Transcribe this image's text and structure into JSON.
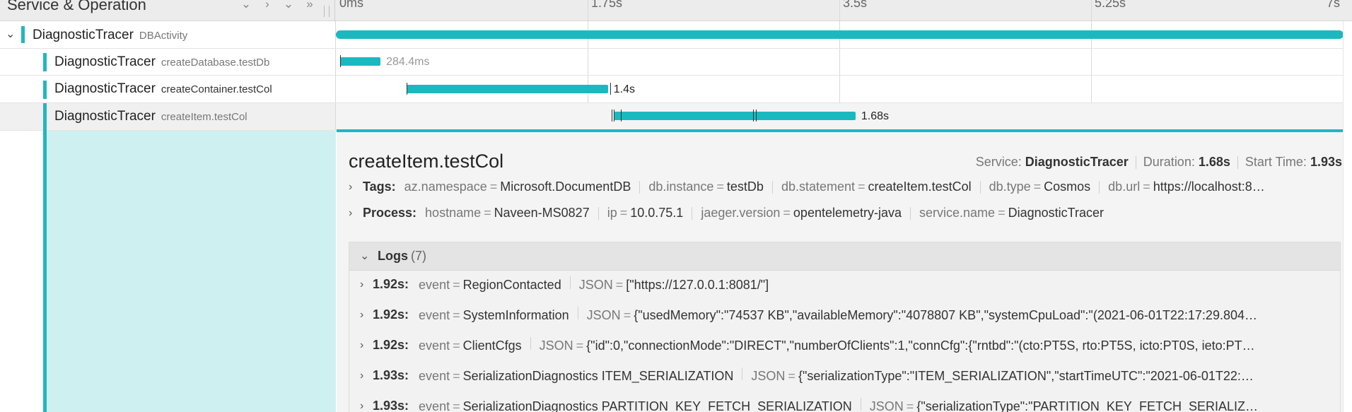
{
  "header": {
    "title": "Service & Operation",
    "icons": [
      "chevron-down-icon",
      "chevron-right-icon",
      "expand-all-icon",
      "collapse-all-icon"
    ],
    "ticks": [
      "0ms",
      "1.75s",
      "3.5s",
      "5.25s",
      "7s"
    ]
  },
  "spans": [
    {
      "service": "DiagnosticTracer",
      "operation": "DBActivity",
      "duration": "",
      "start_s": 0,
      "end_s": 7.0
    },
    {
      "service": "DiagnosticTracer",
      "operation": "createDatabase.testDb",
      "duration": "284.4ms",
      "start_s": 0.03,
      "end_s": 0.31
    },
    {
      "service": "DiagnosticTracer",
      "operation": "createContainer.testCol",
      "duration": "1.4s",
      "start_s": 0.49,
      "end_s": 1.89
    },
    {
      "service": "DiagnosticTracer",
      "operation": "createItem.testCol",
      "duration": "1.68s",
      "start_s": 1.93,
      "end_s": 3.61
    }
  ],
  "detail": {
    "title": "createItem.testCol",
    "service_label": "Service:",
    "service": "DiagnosticTracer",
    "duration_label": "Duration:",
    "duration": "1.68s",
    "start_label": "Start Time:",
    "start": "1.93s",
    "tags_label": "Tags:",
    "tags": [
      {
        "k": "az.namespace",
        "v": "Microsoft.DocumentDB"
      },
      {
        "k": "db.instance",
        "v": "testDb"
      },
      {
        "k": "db.statement",
        "v": "createItem.testCol"
      },
      {
        "k": "db.type",
        "v": "Cosmos"
      },
      {
        "k": "db.url",
        "v": "https://localhost:8…"
      }
    ],
    "process_label": "Process:",
    "process": [
      {
        "k": "hostname",
        "v": "Naveen-MS0827"
      },
      {
        "k": "ip",
        "v": "10.0.75.1"
      },
      {
        "k": "jaeger.version",
        "v": "opentelemetry-java"
      },
      {
        "k": "service.name",
        "v": "DiagnosticTracer"
      }
    ],
    "logs_label": "Logs",
    "logs_count": "(7)",
    "logs": [
      {
        "ts": "1.92s:",
        "event": "RegionContacted",
        "json": "[\"https://127.0.0.1:8081/\"]"
      },
      {
        "ts": "1.92s:",
        "event": "SystemInformation",
        "json": "{\"usedMemory\":\"74537 KB\",\"availableMemory\":\"4078807 KB\",\"systemCpuLoad\":\"(2021-06-01T22:17:29.804…"
      },
      {
        "ts": "1.92s:",
        "event": "ClientCfgs",
        "json": "{\"id\":0,\"connectionMode\":\"DIRECT\",\"numberOfClients\":1,\"connCfg\":{\"rntbd\":\"(cto:PT5S, rto:PT5S, icto:PT0S, ieto:PT…"
      },
      {
        "ts": "1.93s:",
        "event": "SerializationDiagnostics ITEM_SERIALIZATION",
        "json": "{\"serializationType\":\"ITEM_SERIALIZATION\",\"startTimeUTC\":\"2021-06-01T22:…"
      },
      {
        "ts": "1.93s:",
        "event": "SerializationDiagnostics PARTITION_KEY_FETCH_SERIALIZATION",
        "json": "{\"serializationType\":\"PARTITION_KEY_FETCH_SERIALIZ…"
      }
    ]
  },
  "colors": {
    "accent": "#1ab9bf",
    "selected_fill": "#cff0f1"
  }
}
